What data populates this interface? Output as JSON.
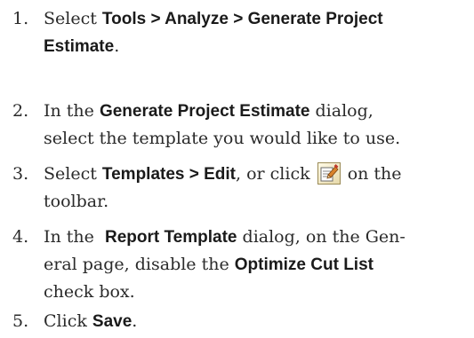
{
  "steps": [
    {
      "number": "1.",
      "lines": [
        {
          "pre": "Select ",
          "bold": "Tools > Analyze > Generate Project"
        },
        {
          "bold": "Estimate",
          "post": "."
        }
      ]
    },
    {
      "number": "2.",
      "lines": [
        {
          "pre": "In the ",
          "bold": "Generate Project Estimate",
          "post": " dialog,"
        },
        {
          "pre": "select the template you would like to use."
        }
      ]
    },
    {
      "number": "3.",
      "lines": [
        {
          "pre": "Select ",
          "bold": "Templates > Edit",
          "mid": ", or click ",
          "icon": "edit-template-icon",
          "post": " on the"
        },
        {
          "pre": "toolbar."
        }
      ]
    },
    {
      "number": "4.",
      "lines": [
        {
          "pre": "In the  ",
          "bold": "Report Template",
          "post": " dialog, on the Gen-"
        },
        {
          "pre": "eral page, disable the ",
          "bold": "Optimize Cut List"
        },
        {
          "pre": "check box."
        }
      ]
    },
    {
      "number": "5.",
      "lines": [
        {
          "pre": "Click ",
          "bold": "Save",
          "post": "."
        }
      ]
    }
  ],
  "icon_name": "edit-template-icon"
}
